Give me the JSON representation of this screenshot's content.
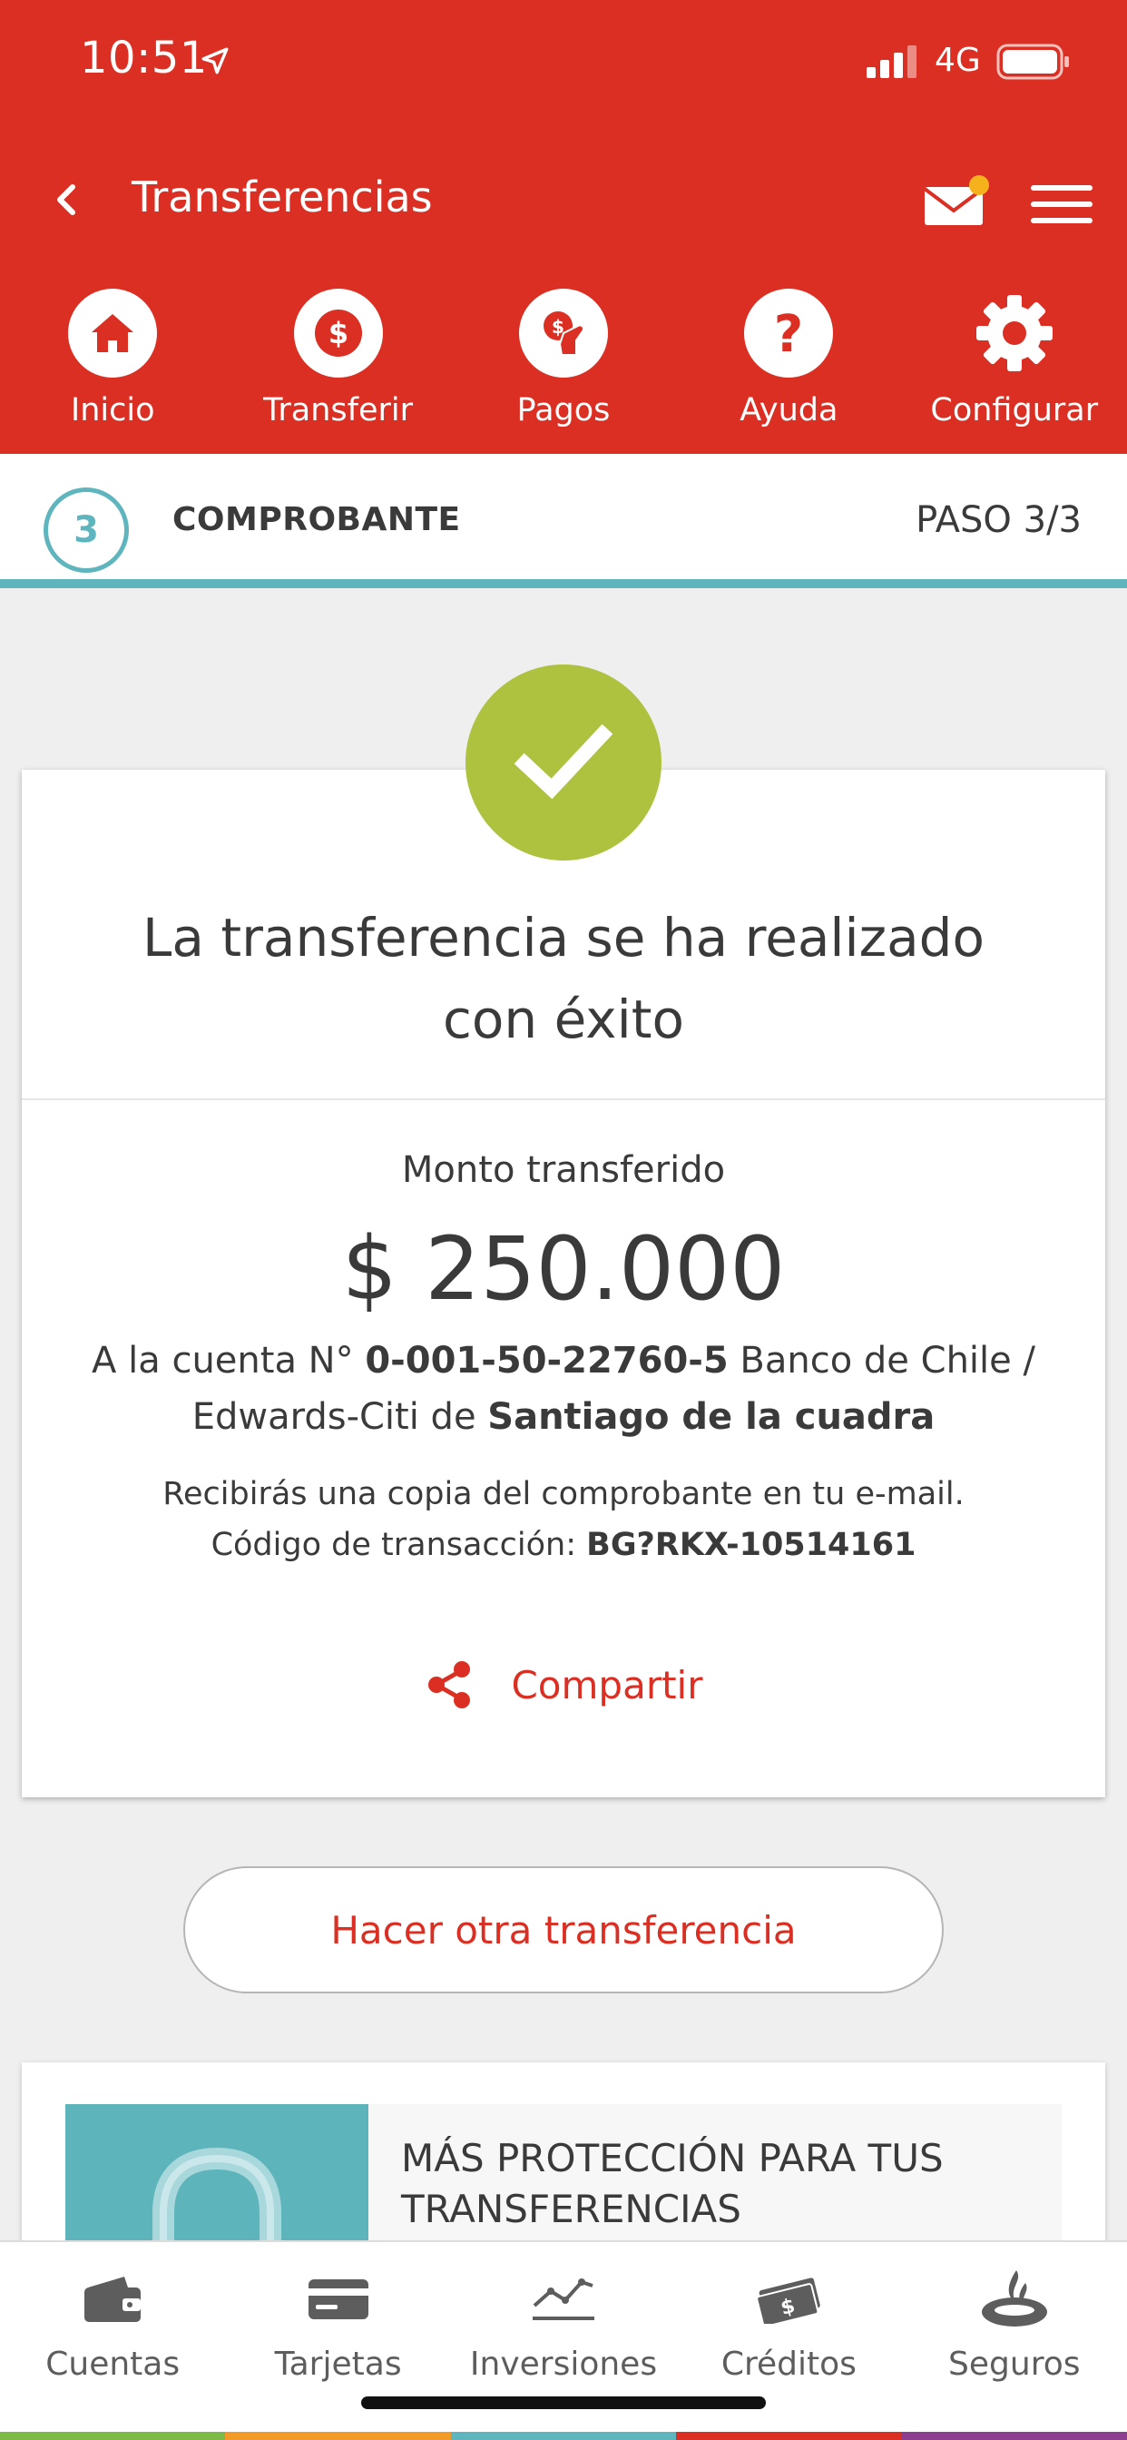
{
  "status_bar": {
    "time": "10:51",
    "network": "4G"
  },
  "header": {
    "title": "Transferencias",
    "shortcuts": [
      {
        "label": "Inicio",
        "icon": "home-icon"
      },
      {
        "label": "Transferir",
        "icon": "dollar-icon"
      },
      {
        "label": "Pagos",
        "icon": "payments-hand-icon"
      },
      {
        "label": "Ayuda",
        "icon": "question-icon"
      },
      {
        "label": "Configurar",
        "icon": "gear-icon"
      }
    ]
  },
  "step": {
    "number": "3",
    "title": "COMPROBANTE",
    "counter": "PASO 3/3"
  },
  "receipt": {
    "message": "La transferencia se ha realizado con éxito",
    "amount_label": "Monto transferido",
    "amount": "$ 250.000",
    "account_prefix": "A la cuenta N° ",
    "account_number": "0-001-50-22760-5",
    "bank_text": " Banco de Chile / Edwards-Citi de ",
    "recipient": "Santiago de la cuadra",
    "copy_note": "Recibirás una copia del comprobante en tu e-mail.",
    "code_label": "Código de transacción: ",
    "code": "BG?RKX-10514161",
    "share_label": "Compartir"
  },
  "actions": {
    "again_label": "Hacer otra transferencia"
  },
  "promo": {
    "title": "MÁS PROTECCIÓN PARA TUS TRANSFERENCIAS"
  },
  "tabbar": {
    "items": [
      {
        "label": "Cuentas",
        "icon": "wallet-icon"
      },
      {
        "label": "Tarjetas",
        "icon": "card-icon"
      },
      {
        "label": "Inversiones",
        "icon": "chart-line-icon"
      },
      {
        "label": "Créditos",
        "icon": "money-icon"
      },
      {
        "label": "Seguros",
        "icon": "flame-logo-icon"
      }
    ]
  },
  "colors": {
    "brand_red": "#da2f22",
    "accent_teal": "#5fb5bd",
    "success_green": "#aec240",
    "notification_dot": "#f6b21d"
  }
}
